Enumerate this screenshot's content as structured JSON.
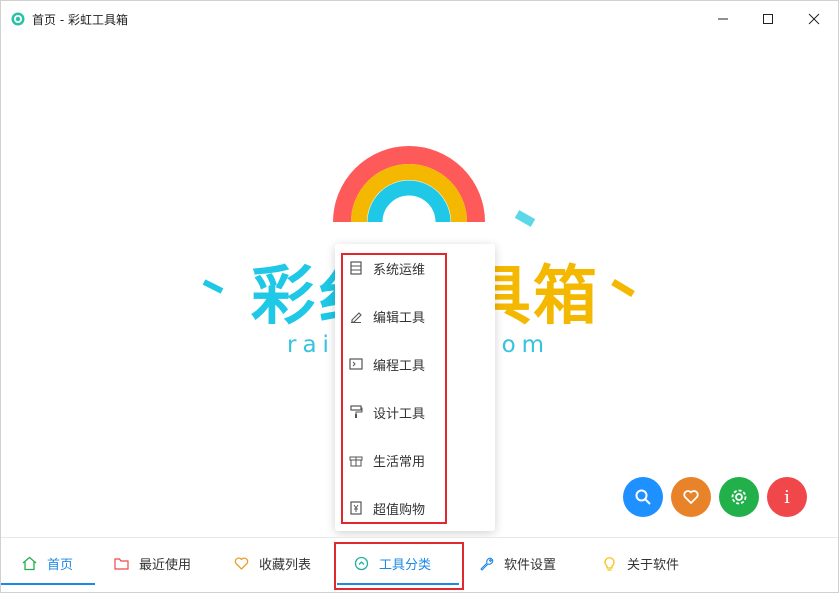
{
  "window": {
    "title": "首页 - 彩虹工具箱",
    "icon": "rainbow-app-icon"
  },
  "logo": {
    "title_visible": "彩",
    "title_hidden_part": "虹",
    "title_right": "具箱",
    "title_middle": "纟",
    "subtitle_left": "rai",
    "subtitle_right": "com"
  },
  "menu": {
    "items": [
      {
        "label": "系统运维",
        "icon": "server-icon"
      },
      {
        "label": "编辑工具",
        "icon": "pen-icon"
      },
      {
        "label": "编程工具",
        "icon": "terminal-icon"
      },
      {
        "label": "设计工具",
        "icon": "paint-roller-icon"
      },
      {
        "label": "生活常用",
        "icon": "gift-icon"
      },
      {
        "label": "超值购物",
        "icon": "yen-icon"
      }
    ]
  },
  "fabs": {
    "search": "search-icon",
    "favorite": "heart-icon",
    "settings": "gear-icon",
    "info_label": "i"
  },
  "tabs": [
    {
      "label": "首页",
      "icon": "home-icon",
      "active": true,
      "color": "#22b04b"
    },
    {
      "label": "最近使用",
      "icon": "folder-icon",
      "active": false,
      "color": "#f0474b"
    },
    {
      "label": "收藏列表",
      "icon": "heart-icon",
      "active": false,
      "color": "#e8a02a"
    },
    {
      "label": "工具分类",
      "icon": "chevron-circle-icon",
      "active": true,
      "color": "#22b0a0"
    },
    {
      "label": "软件设置",
      "icon": "wrench-icon",
      "active": false,
      "color": "#1e88e5"
    },
    {
      "label": "关于软件",
      "icon": "bulb-icon",
      "active": false,
      "color": "#f5c518"
    }
  ],
  "colors": {
    "accent": "#1e88e5",
    "highlight_frame": "#e0282e",
    "logo_cyan": "#1ec8e6",
    "logo_yellow": "#f5b800",
    "logo_red": "#ff5a5a"
  }
}
